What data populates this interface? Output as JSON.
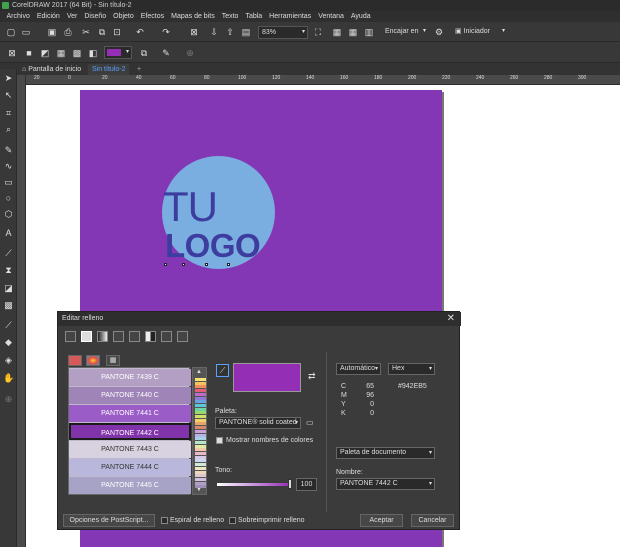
{
  "app": {
    "title": "CorelDRAW 2017 (64 Bit) - Sin título-2"
  },
  "menu": [
    "Archivo",
    "Edición",
    "Ver",
    "Diseño",
    "Objeto",
    "Efectos",
    "Mapas de bits",
    "Texto",
    "Tabla",
    "Herramientas",
    "Ventana",
    "Ayuda"
  ],
  "toolbar": {
    "zoom": "83%",
    "snap": "Encajar en",
    "launch": "Iniciador"
  },
  "tabs": [
    "Pantalla de inicio",
    "Sin título-2"
  ],
  "ruler": {
    "h_labels": [
      "20",
      "0",
      "20",
      "40",
      "60",
      "80",
      "100",
      "120",
      "140",
      "160",
      "180",
      "200",
      "220",
      "240",
      "260",
      "280",
      "300"
    ]
  },
  "artwork": {
    "line1": "TU",
    "line2": "LOGO"
  },
  "colors": {
    "page": "#8437b4",
    "circle": "#7aaee0",
    "logo_text": "#3c3d9e",
    "fill": "#942eb5"
  },
  "dialog": {
    "title": "Editar relleno",
    "swatches": [
      {
        "name": "PANTONE 7439 C",
        "color": "#b39fc4"
      },
      {
        "name": "PANTONE 7440 C",
        "color": "#9f84b8"
      },
      {
        "name": "PANTONE 7441 C",
        "color": "#9a5cc6"
      },
      {
        "name": "PANTONE 7442 C",
        "color": "#8133a9"
      },
      {
        "name": "PANTONE 7443 C",
        "color": "#d8d2e0"
      },
      {
        "name": "PANTONE 7444 C",
        "color": "#b9b8dc"
      },
      {
        "name": "PANTONE 7445 C",
        "color": "#a7a3c6"
      }
    ],
    "palette_label": "Paleta:",
    "palette_value": "PANTONE® solid coated",
    "show_names_label": "Mostrar nombres de colores",
    "tint_label": "Tono:",
    "tint_value": "100",
    "model": "Automático",
    "format": "Hex",
    "cmyk": [
      {
        "k": "C",
        "v": "65"
      },
      {
        "k": "M",
        "v": "96"
      },
      {
        "k": "Y",
        "v": "0"
      },
      {
        "k": "K",
        "v": "0"
      }
    ],
    "hex": "#942EB5",
    "doc_palette": "Paleta de documento",
    "name_label": "Nombre:",
    "name_value": "PANTONE 7442 C",
    "postscript_btn": "Opciones de PostScript...",
    "spiral_label": "Espiral de relleno",
    "overprint_label": "Sobreimprimir relleno",
    "ok_btn": "Aceptar",
    "cancel_btn": "Cancelar"
  }
}
